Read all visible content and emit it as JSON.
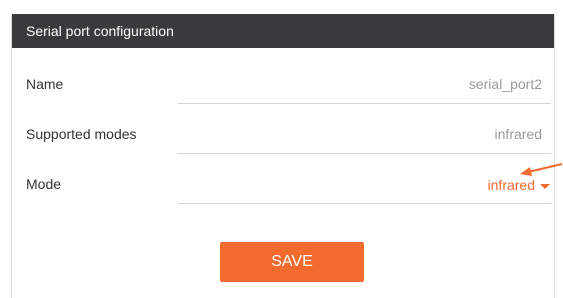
{
  "panel": {
    "title": "Serial port configuration"
  },
  "fields": [
    {
      "label": "Name",
      "value": "serial_port2"
    },
    {
      "label": "Supported modes",
      "value": "infrared"
    },
    {
      "label": "Mode",
      "value": "infrared"
    }
  ],
  "actions": {
    "save_label": "SAVE"
  },
  "colors": {
    "header_bg": "#3a3a3c",
    "accent": "#f26a2e",
    "muted_value": "#9a9a9a"
  },
  "icons": {
    "mode_dropdown": "chevron-down-icon",
    "annotation": "arrow-pointer-icon"
  }
}
